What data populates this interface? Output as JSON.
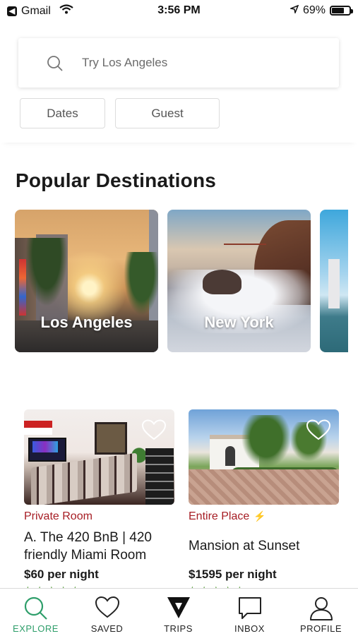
{
  "status_bar": {
    "back_app": "Gmail",
    "time": "3:56 PM",
    "battery": "69%",
    "battery_level": 0.69
  },
  "search": {
    "placeholder": "Try Los Angeles"
  },
  "filters": {
    "dates_label": "Dates",
    "guest_label": "Guest"
  },
  "popular": {
    "title": "Popular Destinations",
    "destinations": [
      {
        "name": "Los Angeles"
      },
      {
        "name": "New York"
      },
      {
        "name": ""
      }
    ]
  },
  "listings": [
    {
      "type": "Private Room",
      "title": "A. The 420 BnB  | 420 friendly Miami Room",
      "price": "$60 per night",
      "instant_book": false
    },
    {
      "type": "Entire Place",
      "title": "Mansion at Sunset",
      "price": "$1595 per night",
      "instant_book": true
    }
  ],
  "tabs": [
    {
      "label": "EXPLORE",
      "icon": "search-icon",
      "active": true
    },
    {
      "label": "SAVED",
      "icon": "heart-icon",
      "active": false
    },
    {
      "label": "TRIPS",
      "icon": "trips-icon",
      "active": false
    },
    {
      "label": "INBOX",
      "icon": "chat-icon",
      "active": false
    },
    {
      "label": "PROFILE",
      "icon": "profile-icon",
      "active": false
    }
  ],
  "colors": {
    "accent": "#2e9e6a",
    "listing_type": "#a61d24",
    "instant_bolt": "#f5c518"
  }
}
